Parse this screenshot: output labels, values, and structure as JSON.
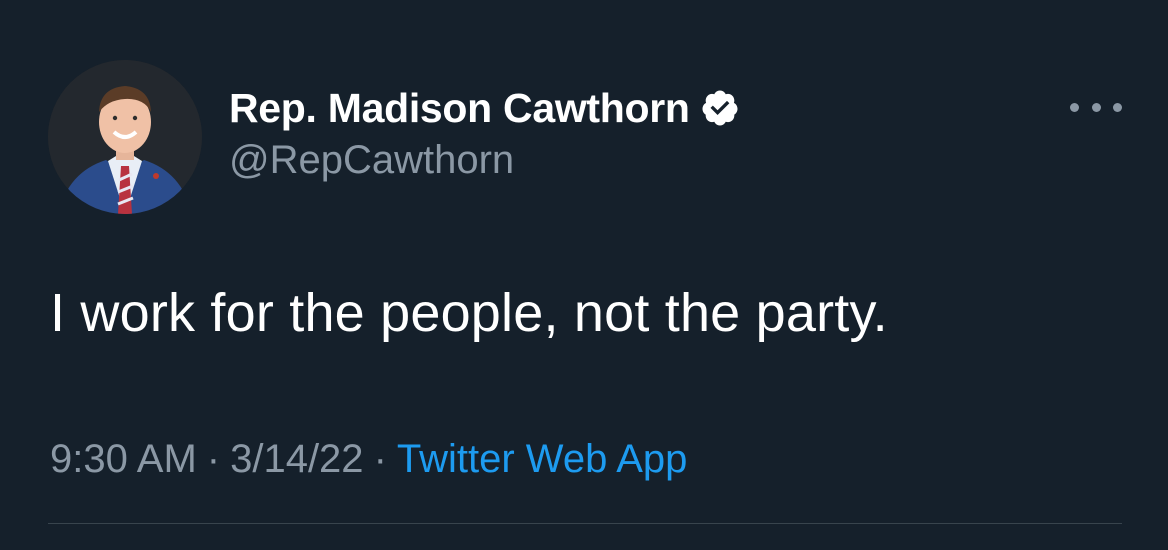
{
  "tweet": {
    "author": {
      "display_name": "Rep. Madison Cawthorn",
      "handle": "@RepCawthorn",
      "verified": true,
      "avatar_icon": "profile-photo"
    },
    "text": "I work for the people, not the party.",
    "time": "9:30 AM",
    "date": "3/14/22",
    "separator": "·",
    "source": "Twitter Web App"
  },
  "colors": {
    "background": "#15202b",
    "primary_text": "#ffffff",
    "secondary_text": "#8b98a5",
    "link": "#1d9bf0",
    "divider": "#38444d"
  },
  "icons": {
    "more": "more-options-icon",
    "verified": "verified-badge-icon"
  }
}
